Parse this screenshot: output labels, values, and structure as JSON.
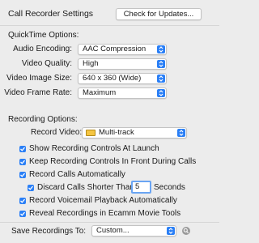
{
  "header": {
    "title": "Call Recorder Settings",
    "check_updates_label": "Check for Updates..."
  },
  "quicktime": {
    "section_label": "QuickTime Options:",
    "audio_encoding_label": "Audio Encoding:",
    "audio_encoding_value": "AAC Compression",
    "video_quality_label": "Video Quality:",
    "video_quality_value": "High",
    "video_size_label": "Video Image Size:",
    "video_size_value": "640 x 360 (Wide)",
    "frame_rate_label": "Video Frame Rate:",
    "frame_rate_value": "Maximum"
  },
  "recording": {
    "section_label": "Recording Options:",
    "record_video_label": "Record Video:",
    "record_video_value": "Multi-track",
    "options": [
      {
        "label": "Show Recording Controls At Launch",
        "checked": true
      },
      {
        "label": "Keep Recording Controls In Front During Calls",
        "checked": true
      },
      {
        "label": "Record Calls Automatically",
        "checked": true
      },
      {
        "label": "Discard Calls Shorter Than",
        "checked": true
      },
      {
        "label": "Record Voicemail Playback Automatically",
        "checked": true
      },
      {
        "label": "Reveal Recordings in Ecamm Movie Tools",
        "checked": true
      }
    ],
    "discard_seconds_value": "5",
    "seconds_label": "Seconds"
  },
  "save": {
    "label": "Save Recordings To:",
    "value": "Custom..."
  },
  "colors": {
    "accent": "#2a7ff6",
    "background": "#ececec"
  },
  "icons": {
    "select_arrows": "updown-chevron-icon",
    "checkbox": "checkmark-icon",
    "reveal": "magnifier-icon"
  }
}
